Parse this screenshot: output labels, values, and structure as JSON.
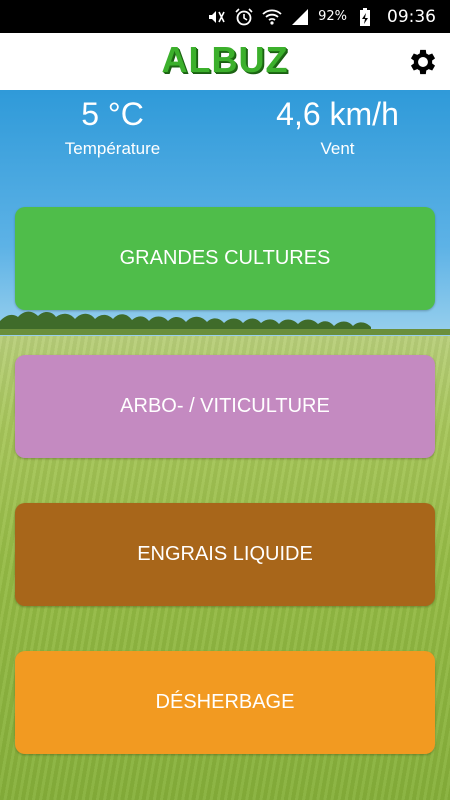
{
  "status_bar": {
    "battery_percent": "92%",
    "time": "09:36",
    "icons": [
      "mute-icon",
      "alarm-icon",
      "wifi-icon",
      "signal-icon",
      "battery-charging-icon"
    ]
  },
  "header": {
    "logo_text": "ALBUZ",
    "logo_color": "#3cb02c",
    "settings_icon": "gear-icon"
  },
  "weather": {
    "temperature_value": "5 °C",
    "temperature_label": "Température",
    "wind_value": "4,6 km/h",
    "wind_label": "Vent"
  },
  "menu": {
    "buttons": [
      {
        "label": "GRANDES CULTURES",
        "color": "#4fbd4a"
      },
      {
        "label": "ARBO- / VITICULTURE",
        "color": "#c48ac1"
      },
      {
        "label": "ENGRAIS LIQUIDE",
        "color": "#a8661a"
      },
      {
        "label": "DÉSHERBAGE",
        "color": "#f29a21"
      }
    ]
  }
}
